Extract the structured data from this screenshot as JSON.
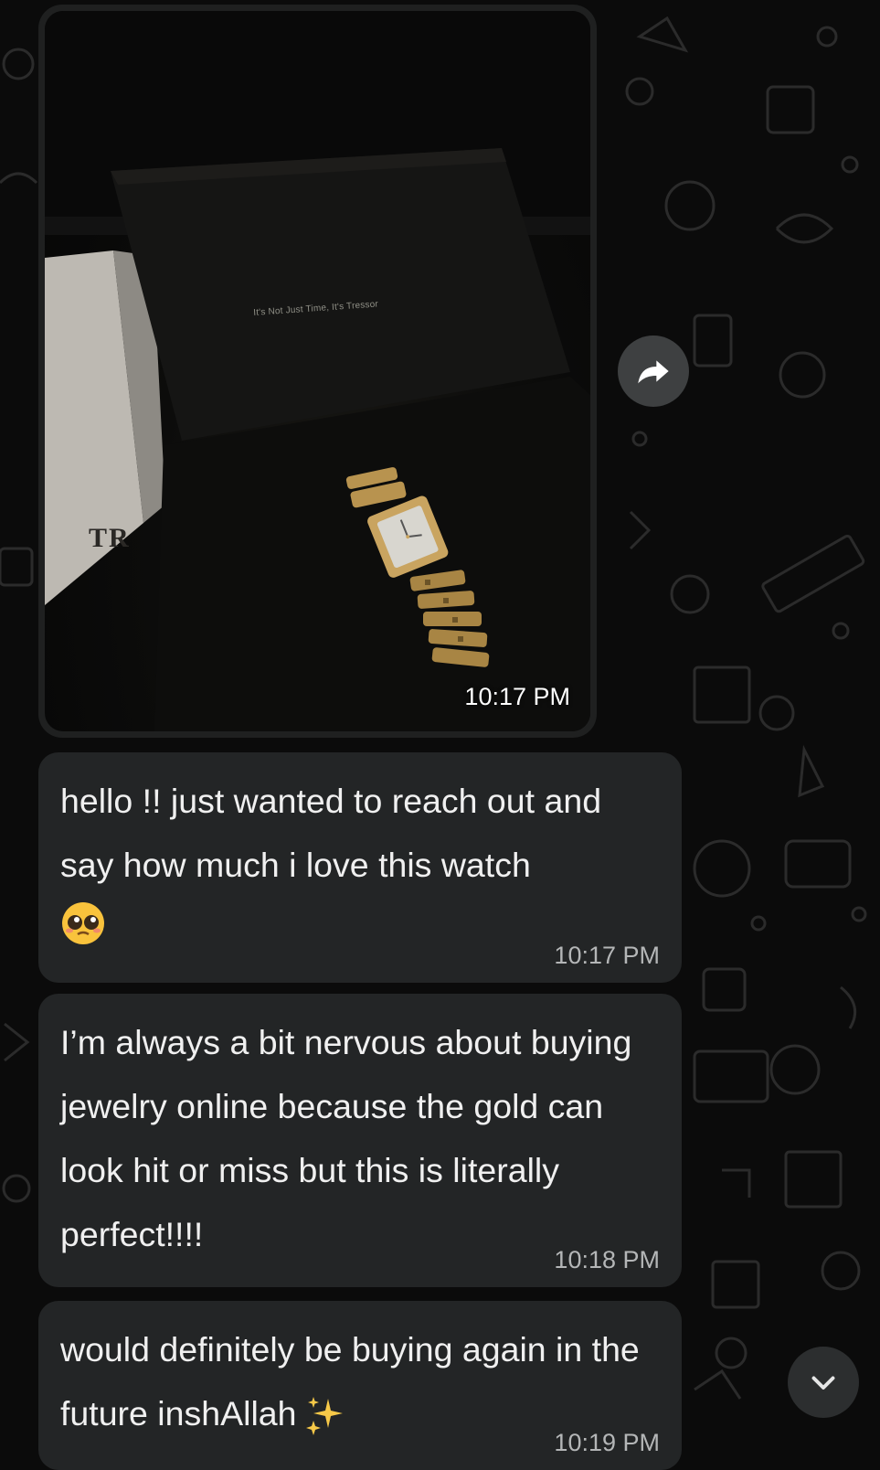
{
  "chat": {
    "image_message": {
      "box_tagline": "It's Not Just Time, It's Tressor",
      "box_brand": "TR",
      "time": "10:17 PM"
    },
    "messages": [
      {
        "text": "hello !! just wanted to reach out and say how much i love this watch",
        "emoji": "pleading-face-emoji",
        "time": "10:17 PM"
      },
      {
        "text": "I’m always a bit nervous about buying jewelry online because the gold can look hit or miss but this is literally perfect!!!!",
        "time": "10:18 PM"
      },
      {
        "text": "would definitely be buying again in the future inshAllah",
        "emoji": "sparkles-emoji",
        "time": "10:19 PM"
      }
    ]
  },
  "icons": {
    "forward": "forward-arrow-icon",
    "scroll_down": "chevron-down-icon"
  },
  "colors": {
    "background": "#0b0b0b",
    "bubble": "#232526",
    "text": "#f0f0f0",
    "timestamp": "#b4b6b7",
    "round_button": "#3e4041"
  }
}
